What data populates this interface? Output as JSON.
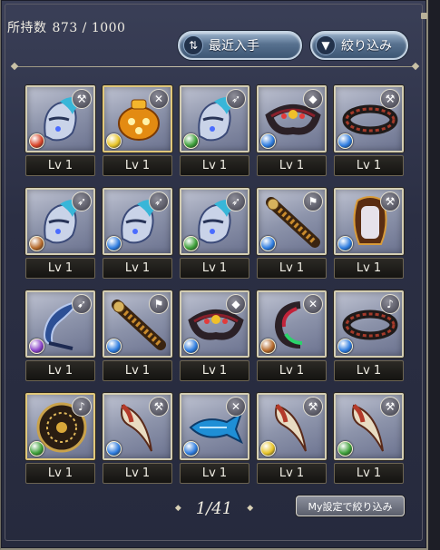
{
  "header": {
    "count_label": "所持数",
    "count_value": "873 / 1000",
    "recent_button_label": "最近入手",
    "filter_button_label": "絞り込み"
  },
  "colors": {
    "fire": "#d9452a",
    "water": "#2f7de0",
    "earth": "#b56a2c",
    "wind": "#3ea03a",
    "light": "#e8c52a",
    "dark": "#8a44c9"
  },
  "items": [
    {
      "art": "blue-helm",
      "element": "fire",
      "type_icon": "axe-icon",
      "level": "Lv 1"
    },
    {
      "art": "gold-censer",
      "element": "light",
      "type_icon": "crossed-swords-icon",
      "level": "Lv 1"
    },
    {
      "art": "blue-helm",
      "element": "wind",
      "type_icon": "spear-icon",
      "level": "Lv 1"
    },
    {
      "art": "red-bracelet",
      "element": "water",
      "type_icon": "gem-icon",
      "level": "Lv 1"
    },
    {
      "art": "dark-bracelet",
      "element": "water",
      "type_icon": "axe-icon",
      "level": "Lv 1"
    },
    {
      "art": "blue-helm",
      "element": "earth",
      "type_icon": "spear-icon",
      "level": "Lv 1"
    },
    {
      "art": "blue-helm",
      "element": "water",
      "type_icon": "spear-icon",
      "level": "Lv 1"
    },
    {
      "art": "blue-helm",
      "element": "wind",
      "type_icon": "spear-icon",
      "level": "Lv 1"
    },
    {
      "art": "scroll",
      "element": "water",
      "type_icon": "hammer-icon",
      "level": "Lv 1"
    },
    {
      "art": "mirror",
      "element": "water",
      "type_icon": "axe-icon",
      "level": "Lv 1"
    },
    {
      "art": "blue-blade",
      "element": "dark",
      "type_icon": "bow-icon",
      "level": "Lv 1"
    },
    {
      "art": "scroll",
      "element": "water",
      "type_icon": "hammer-icon",
      "level": "Lv 1"
    },
    {
      "art": "red-bracelet",
      "element": "water",
      "type_icon": "gem-icon",
      "level": "Lv 1"
    },
    {
      "art": "green-ring",
      "element": "earth",
      "type_icon": "crossed-swords-icon",
      "level": "Lv 1"
    },
    {
      "art": "dark-bracelet",
      "element": "water",
      "type_icon": "harp-icon",
      "level": "Lv 1"
    },
    {
      "art": "gold-shield",
      "element": "wind",
      "type_icon": "harp-icon",
      "level": "Lv 1"
    },
    {
      "art": "fang",
      "element": "water",
      "type_icon": "axe-icon",
      "level": "Lv 1"
    },
    {
      "art": "blue-fish",
      "element": "water",
      "type_icon": "crossed-swords-icon",
      "level": "Lv 1"
    },
    {
      "art": "fang",
      "element": "light",
      "type_icon": "axe-icon",
      "level": "Lv 1"
    },
    {
      "art": "fang",
      "element": "wind",
      "type_icon": "axe-icon",
      "level": "Lv 1"
    }
  ],
  "pager": {
    "current": "1/41",
    "my_filter_label": "My設定で絞り込み"
  }
}
